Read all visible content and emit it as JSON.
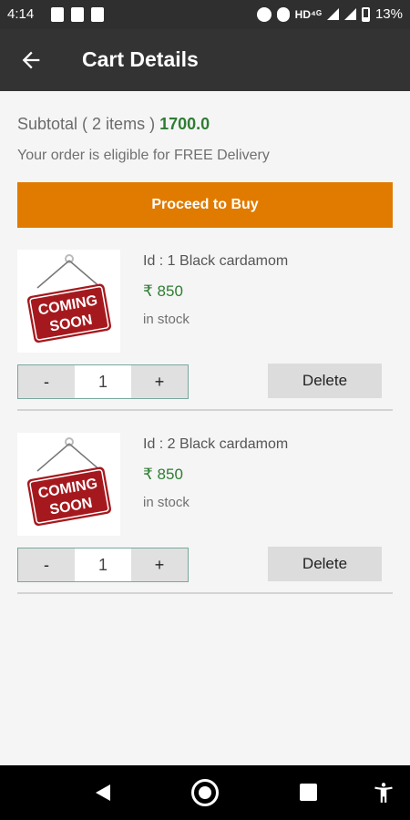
{
  "status_bar": {
    "time": "4:14",
    "network": "HD⁴ᴳ",
    "battery": "13%"
  },
  "app_bar": {
    "title": "Cart Details"
  },
  "summary": {
    "subtotal_label": "Subtotal ( 2 items )",
    "subtotal_amount": "1700.0",
    "delivery_note": "Your order is eligible for FREE Delivery"
  },
  "proceed_label": "Proceed to Buy",
  "image_text": {
    "line1": "COMING",
    "line2": "SOON"
  },
  "items": [
    {
      "name": "Id : 1 Black cardamom",
      "price": "₹ 850",
      "stock": "in stock",
      "qty": "1",
      "minus": "-",
      "plus": "+",
      "delete": "Delete"
    },
    {
      "name": "Id : 2 Black cardamom",
      "price": "₹ 850",
      "stock": "in stock",
      "qty": "1",
      "minus": "-",
      "plus": "+",
      "delete": "Delete"
    }
  ]
}
